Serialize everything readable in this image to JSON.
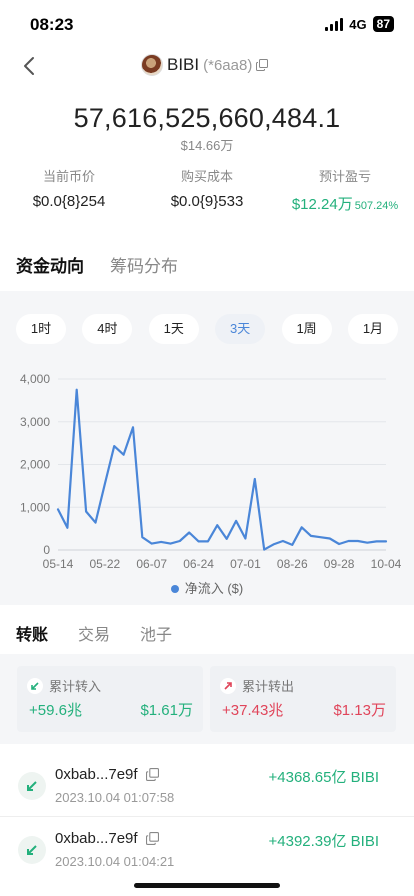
{
  "status_bar": {
    "time": "08:23",
    "network": "4G",
    "battery": "87"
  },
  "header": {
    "token_name": "BIBI",
    "token_address": "(*6aa8)"
  },
  "balance": {
    "amount": "57,616,525,660,484.1",
    "usd_value": "$14.66万"
  },
  "stats": [
    {
      "label": "当前币价",
      "value": "$0.0{8}254",
      "pct": ""
    },
    {
      "label": "购买成本",
      "value": "$0.0{9}533",
      "pct": ""
    },
    {
      "label": "预计盈亏",
      "value": "$12.24万",
      "pct": "507.24%"
    }
  ],
  "main_tabs": [
    "资金动向",
    "筹码分布"
  ],
  "time_tabs": [
    "1时",
    "4时",
    "1天",
    "3天",
    "1周",
    "1月"
  ],
  "active_time_tab": "3天",
  "chart_data": {
    "type": "line",
    "title": "",
    "xlabel": "",
    "ylabel": "",
    "ylim": [
      0,
      4000
    ],
    "y_ticks": [
      "0",
      "1,000",
      "2,000",
      "3,000",
      "4,000"
    ],
    "x_ticks": [
      "05-14",
      "05-22",
      "06-07",
      "06-24",
      "07-01",
      "08-26",
      "09-28",
      "10-04"
    ],
    "grid": "horizontal",
    "legend_position": "bottom",
    "series": [
      {
        "name": "净流入 ($)",
        "color": "#4a86d8",
        "values": [
          950,
          520,
          3750,
          900,
          640,
          1550,
          2430,
          2230,
          2870,
          300,
          150,
          190,
          150,
          210,
          410,
          200,
          200,
          580,
          260,
          680,
          270,
          1660,
          10,
          130,
          210,
          120,
          530,
          330,
          300,
          270,
          140,
          210,
          210,
          170,
          200,
          200
        ]
      }
    ]
  },
  "legend": {
    "label": "净流入 ($)"
  },
  "sub_tabs": [
    "转账",
    "交易",
    "池子"
  ],
  "summary": {
    "in": {
      "label": "累计转入",
      "amount": "+59.6兆",
      "usd": "$1.61万"
    },
    "out": {
      "label": "累计转出",
      "amount": "+37.43兆",
      "usd": "$1.13万"
    }
  },
  "transactions": [
    {
      "address": "0xbab...7e9f",
      "time": "2023.10.04 01:07:58",
      "amount": "+4368.65亿 BIBI"
    },
    {
      "address": "0xbab...7e9f",
      "time": "2023.10.04 01:04:21",
      "amount": "+4392.39亿 BIBI"
    }
  ],
  "colors": {
    "accent_blue": "#4a86d8",
    "positive_green": "#23b07c",
    "negative_red": "#e0455a"
  }
}
